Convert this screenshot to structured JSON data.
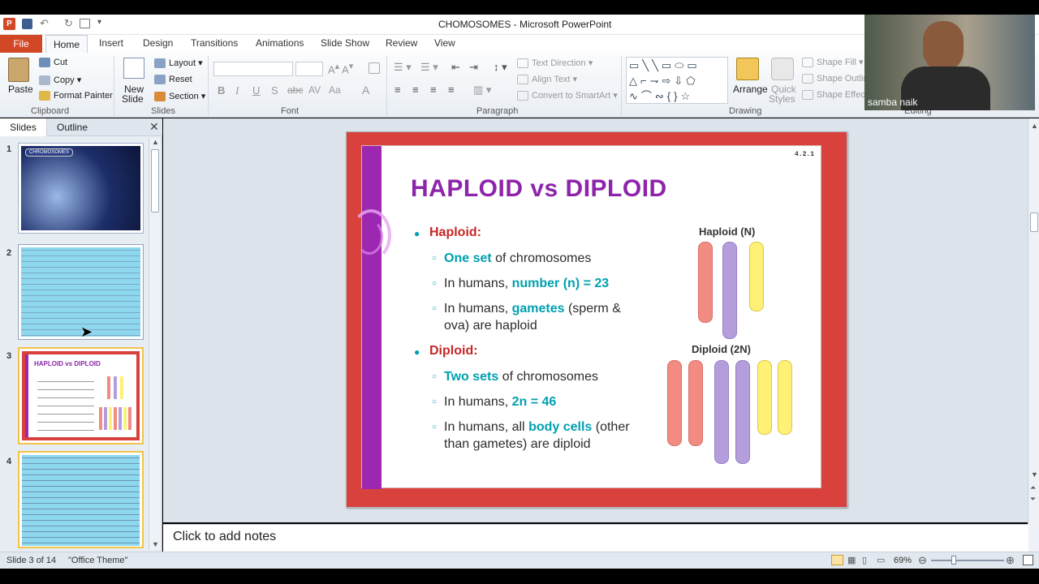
{
  "window": {
    "title": "CHOMOSOMES  -  Microsoft PowerPoint"
  },
  "tabs": [
    "File",
    "Home",
    "Insert",
    "Design",
    "Transitions",
    "Animations",
    "Slide Show",
    "Review",
    "View"
  ],
  "clipboard": {
    "paste": "Paste",
    "cut": "Cut",
    "copy": "Copy",
    "format_painter": "Format Painter",
    "label": "Clipboard"
  },
  "slides_group": {
    "new_slide": "New",
    "new_slide2": "Slide",
    "layout": "Layout",
    "reset": "Reset",
    "section": "Section",
    "label": "Slides"
  },
  "font_group": {
    "label": "Font"
  },
  "paragraph_group": {
    "text_direction": "Text Direction",
    "align_text": "Align Text",
    "convert": "Convert to SmartArt",
    "label": "Paragraph"
  },
  "drawing_group": {
    "arrange": "Arrange",
    "quick_styles": "Quick",
    "quick_styles2": "Styles",
    "shape_fill": "Shape Fill",
    "shape_outline": "Shape Outline",
    "shape_effects": "Shape Effects",
    "label": "Drawing",
    "editing": "Editing"
  },
  "pane": {
    "tab_slides": "Slides",
    "tab_outline": "Outline"
  },
  "thumbnails": [
    {
      "num": "1",
      "title": "CHROMOSOMES"
    },
    {
      "num": "2"
    },
    {
      "num": "3",
      "title": "HAPLOID vs DIPLOID"
    },
    {
      "num": "4"
    }
  ],
  "slide": {
    "tag": "4.2.1",
    "title": "HAPLOID vs DIPLOID",
    "haploid_head": "Haploid:",
    "h1_hl": "One set",
    "h1_rest": " of chromosomes",
    "h2_pre": "In humans, ",
    "h2_hl": "number (n) = 23",
    "h3_pre": "In humans, ",
    "h3_hl": "gametes",
    "h3_rest": " (sperm &",
    "h3_line2": "ova) are haploid",
    "diploid_head": "Diploid:",
    "d1_hl": "Two sets",
    "d1_rest": " of chromosomes",
    "d2_pre": "In humans, ",
    "d2_hl": "2n = 46",
    "d3_pre": "In humans, all ",
    "d3_hl": "body cells",
    "d3_rest": " (other",
    "d3_line2": "than gametes) are diploid",
    "label_haploid": "Haploid (N)",
    "label_diploid": "Diploid (2N)"
  },
  "notes": {
    "placeholder": "Click to add notes"
  },
  "status": {
    "slide": "Slide 3 of 14",
    "theme": "\"Office Theme\"",
    "zoom": "69%"
  },
  "webcam": {
    "name": "samba naik"
  },
  "colors": {
    "file_tab": "#d24726",
    "slide_border": "#d9413c",
    "title_purple": "#8e24aa",
    "haploid_red": "#c62828",
    "highlight_teal": "#00a0b0"
  }
}
